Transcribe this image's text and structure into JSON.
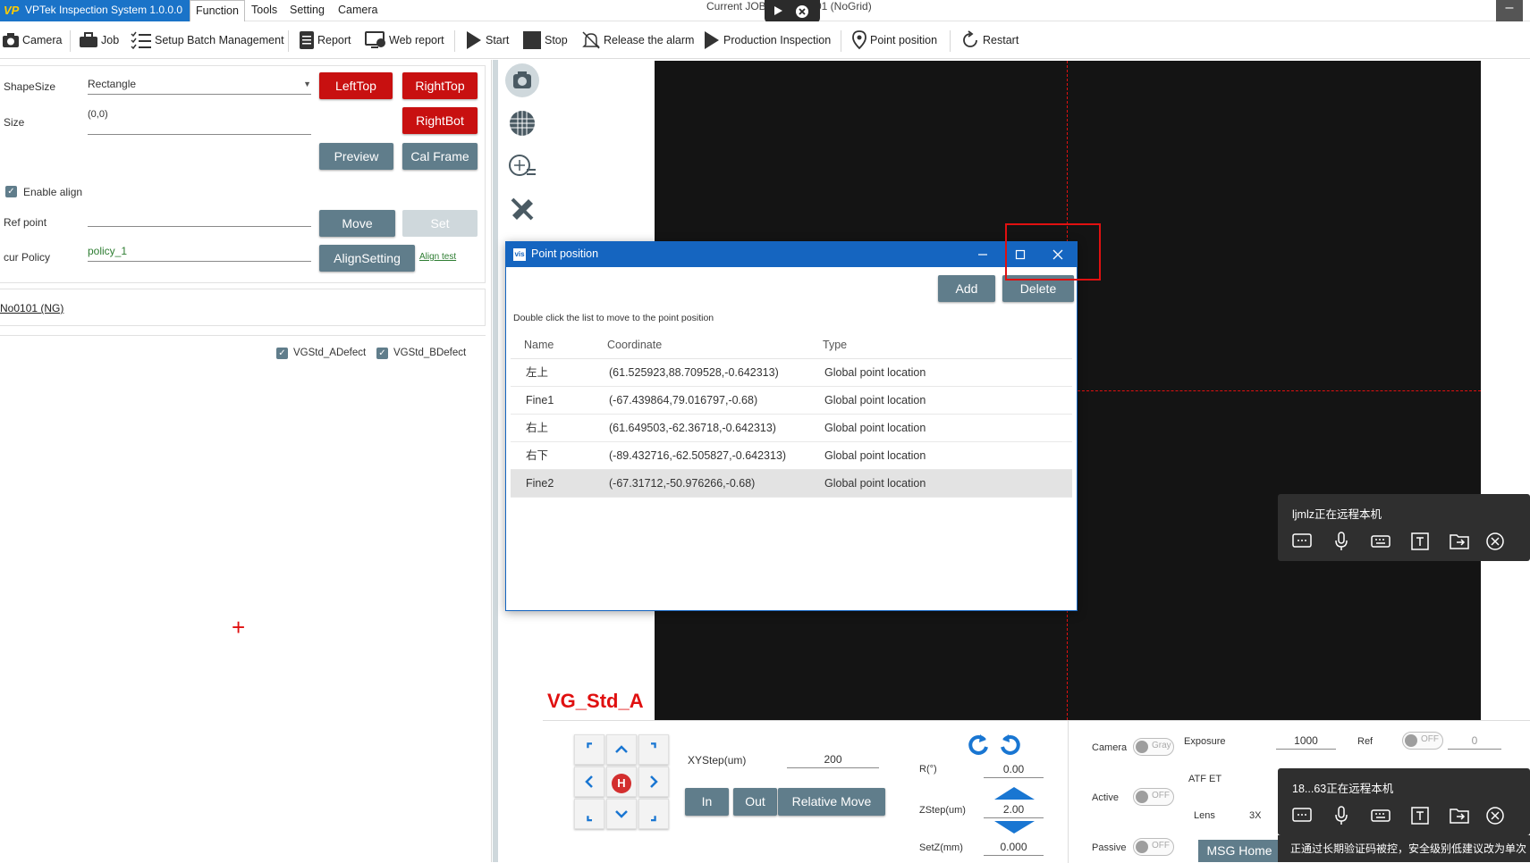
{
  "app": {
    "logo_text": "VP",
    "title": "VPTek Inspection System 1.0.0.0",
    "current_job_prefix": "Current JOB",
    "current_job_suffix": "01 (NoGrid)",
    "minimize_glyph": "–"
  },
  "menu": [
    {
      "label": "Function",
      "active": true
    },
    {
      "label": "Tools"
    },
    {
      "label": "Setting"
    },
    {
      "label": "Camera"
    }
  ],
  "toolbar": {
    "camera": "Camera",
    "job": "Job",
    "setup_batch": "Setup Batch Management",
    "report": "Report",
    "web_report": "Web report",
    "start": "Start",
    "stop": "Stop",
    "release_alarm": "Release the alarm",
    "production_inspection": "Production Inspection",
    "point_position": "Point position",
    "restart": "Restart"
  },
  "left": {
    "shape_size_label": "ShapeSize",
    "shape_size_value": "Rectangle",
    "size_label": "Size",
    "size_value": "(0,0)",
    "btn_lefttop": "LeftTop",
    "btn_righttop": "RightTop",
    "btn_rightbot": "RightBot",
    "btn_preview": "Preview",
    "btn_calframe": "Cal Frame",
    "enable_align": "Enable align",
    "ref_point_label": "Ref point",
    "btn_move": "Move",
    "btn_set": "Set",
    "cur_policy_label": "cur Policy",
    "cur_policy_value": "policy_1",
    "btn_alignsetting": "AlignSetting",
    "align_test": "Align test",
    "item_link": "No0101 (NG)",
    "check_a": "VGStd_ADefect",
    "check_b": "VGStd_BDefect",
    "crosshair": "+"
  },
  "view": {
    "camera_label": "VG_Std_A"
  },
  "dialog": {
    "icon_text": "vis",
    "title": "Point position",
    "btn_add": "Add",
    "btn_delete": "Delete",
    "hint": "Double click the list to move to the point position",
    "columns": {
      "name": "Name",
      "coordinate": "Coordinate",
      "type": "Type"
    },
    "rows": [
      {
        "name": "左上",
        "coordinate": "(61.525923,88.709528,-0.642313)",
        "type": "Global point location"
      },
      {
        "name": "Fine1",
        "coordinate": "(-67.439864,79.016797,-0.68)",
        "type": "Global point location"
      },
      {
        "name": "右上",
        "coordinate": "(61.649503,-62.36718,-0.642313)",
        "type": "Global point location"
      },
      {
        "name": "右下",
        "coordinate": "(-89.432716,-62.505827,-0.642313)",
        "type": "Global point location"
      },
      {
        "name": "Fine2",
        "coordinate": "(-67.31712,-50.976266,-0.68)",
        "type": "Global point location"
      }
    ],
    "selected_row": 4
  },
  "bottom": {
    "home_label": "H",
    "xystep_label": "XYStep(um)",
    "xystep_value": "200",
    "btn_in": "In",
    "btn_out": "Out",
    "btn_relative_move": "Relative Move",
    "r_label": "R(°)",
    "r_value": "0.00",
    "zstep_label": "ZStep(um)",
    "zstep_value": "2.00",
    "setz_label": "SetZ(mm)",
    "setz_value": "0.000",
    "camera_label": "Camera",
    "camera_toggle": "Gray",
    "active_label": "Active",
    "active_toggle": "OFF",
    "passive_label": "Passive",
    "passive_toggle": "OFF",
    "exposure_label": "Exposure",
    "exposure_value": "1000",
    "atf_label": "ATF ET",
    "lens_label": "Lens",
    "lens_value": "3X",
    "ref_label": "Ref",
    "ref_toggle": "OFF",
    "ref_value": "0",
    "msg_home": "MSG Home"
  },
  "remote": {
    "popup1_text": "ljmlz正在远程本机",
    "popup2_text": "18...63正在远程本机",
    "banner": "正通过长期验证码被控，安全级别低建议改为单次"
  }
}
